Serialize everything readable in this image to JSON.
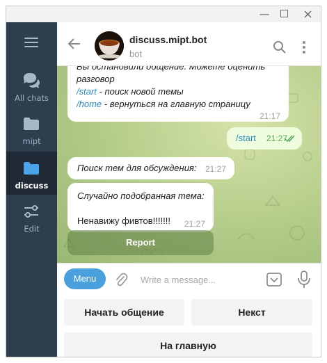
{
  "window": {
    "controls": {
      "minimize": "—"
    }
  },
  "sidebar": {
    "folders": [
      {
        "label": "All chats",
        "icon": "chats-icon"
      },
      {
        "label": "mipt",
        "icon": "folder-icon"
      },
      {
        "label": "discuss",
        "icon": "folder-icon",
        "active": true
      },
      {
        "label": "Edit",
        "icon": "sliders-icon"
      }
    ]
  },
  "header": {
    "title": "discuss.mipt.bot",
    "subtitle": "bot"
  },
  "messages": [
    {
      "from": "bot",
      "lines": [
        {
          "text": "Вы остановили общение. Можете оценить"
        },
        {
          "text": "разговор"
        },
        {
          "cmd": "/start",
          "text": " - поиск новой темы"
        },
        {
          "cmd": "/home",
          "text": " - вернуться на главную страницу"
        }
      ],
      "time": "21:17"
    },
    {
      "from": "me",
      "text": "/start",
      "time": "21:27",
      "status": "read"
    },
    {
      "from": "bot",
      "text": "Поиск тем для обсуждения:",
      "time": "21:27"
    },
    {
      "from": "bot",
      "text": "Случайно подобранная тема:",
      "text2": "Ненавижу фивтов!!!!!!!",
      "time": "21:27",
      "inline_button": "Report"
    }
  ],
  "input": {
    "menu_label": "Menu",
    "placeholder": "Write a message..."
  },
  "keyboard": {
    "buttons": [
      "Начать общение",
      "Некст",
      "На главную"
    ]
  },
  "colors": {
    "sidebar": "#2e3e4f",
    "accent": "#4a9fdd",
    "outgoing_bubble": "#effdde",
    "link": "#2a8ac4"
  }
}
